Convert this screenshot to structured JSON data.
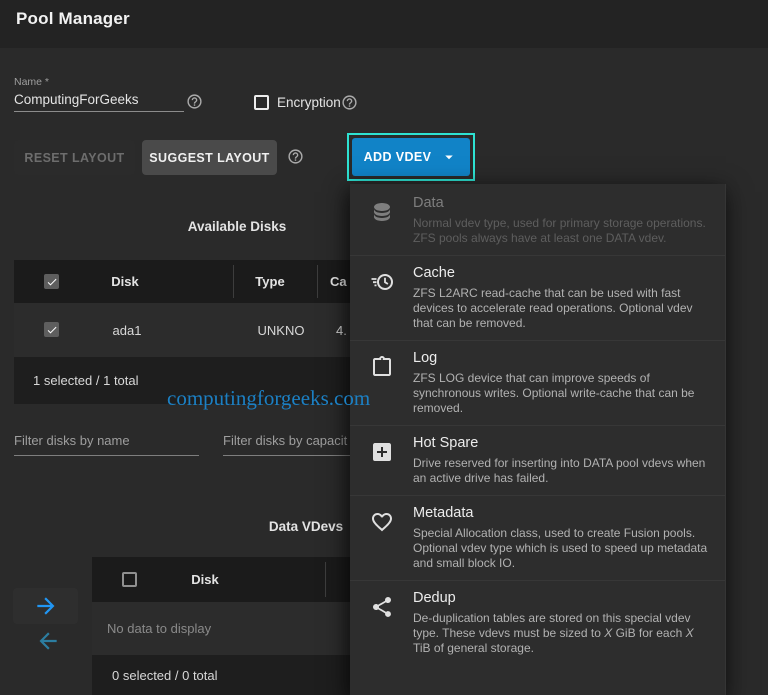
{
  "app": {
    "title": "Pool Manager"
  },
  "form": {
    "name_label": "Name *",
    "name_value": "ComputingForGeeks",
    "encryption_label": "Encryption"
  },
  "toolbar": {
    "reset_label": "RESET LAYOUT",
    "suggest_label": "SUGGEST LAYOUT",
    "add_vdev_label": "ADD VDEV"
  },
  "available_disks": {
    "title": "Available Disks",
    "columns": {
      "disk": "Disk",
      "type": "Type",
      "capacity": "Ca"
    },
    "rows": [
      {
        "selected": true,
        "disk": "ada1",
        "type": "UNKNO",
        "capacity": "4."
      }
    ],
    "footer": "1 selected / 1 total",
    "filter_name_placeholder": "Filter disks by name",
    "filter_capacity_placeholder": "Filter disks by capacit"
  },
  "data_vdevs": {
    "title": "Data VDevs",
    "columns": {
      "disk": "Disk"
    },
    "empty_text": "No data to display",
    "footer": "0 selected / 0 total"
  },
  "vdev_menu": {
    "items": [
      {
        "name": "Data",
        "icon": "database-icon",
        "disabled": true,
        "description": "Normal vdev type, used for primary storage operations. ZFS pools always have at least one DATA vdev."
      },
      {
        "name": "Cache",
        "icon": "clock-fast-icon",
        "disabled": false,
        "description": "ZFS L2ARC read-cache that can be used with fast devices to accelerate read operations. Optional vdev that can be removed."
      },
      {
        "name": "Log",
        "icon": "clipboard-icon",
        "disabled": false,
        "description": "ZFS LOG device that can improve speeds of synchronous writes. Optional write-cache that can be removed."
      },
      {
        "name": "Hot Spare",
        "icon": "plus-box-icon",
        "disabled": false,
        "description": "Drive reserved for inserting into DATA pool vdevs when an active drive has failed."
      },
      {
        "name": "Metadata",
        "icon": "heart-icon",
        "disabled": false,
        "description": "Special Allocation class, used to create Fusion pools. Optional vdev type which is used to speed up metadata and small block IO."
      },
      {
        "name": "Dedup",
        "icon": "share-icon",
        "disabled": false,
        "description": "De-duplication tables are stored on this special vdev type. These vdevs must be sized to X GiB for each X TiB of general storage."
      }
    ]
  },
  "watermark": "computingforgeeks.com",
  "colors": {
    "primary_button_blue": "#1183c7",
    "highlight_cyan": "#2ee2d2",
    "watermark_blue": "#1c80c4",
    "arrow_right_blue": "#2196f3",
    "arrow_left_teal": "#2c7da0"
  }
}
